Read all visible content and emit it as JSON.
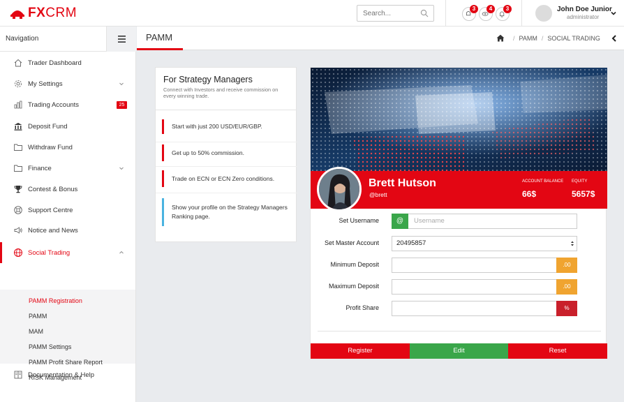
{
  "brand": {
    "fx": "FX",
    "crm": "CRM"
  },
  "header": {
    "search_placeholder": "Search...",
    "notifications": [
      {
        "icon": "bell-alt-icon",
        "count": "3"
      },
      {
        "icon": "eye-icon",
        "count": "4"
      },
      {
        "icon": "bell-icon",
        "count": "3"
      }
    ],
    "user": {
      "name": "John Doe Junior",
      "role": "administrator"
    }
  },
  "sidebar": {
    "title": "Navigation",
    "items": [
      {
        "label": "Trader Dashboard",
        "icon": "home-icon"
      },
      {
        "label": "My Settings",
        "icon": "gear-icon",
        "expand": true
      },
      {
        "label": "Trading Accounts",
        "icon": "bar-chart-icon",
        "badge": "25"
      },
      {
        "label": "Deposit Fund",
        "icon": "bank-icon"
      },
      {
        "label": "Withdraw Fund",
        "icon": "folder-icon"
      },
      {
        "label": "Finance",
        "icon": "folder-icon",
        "expand": true
      },
      {
        "label": "Contest & Bonus",
        "icon": "trophy-icon"
      },
      {
        "label": "Support Centre",
        "icon": "lifebuoy-icon"
      },
      {
        "label": "Notice and News",
        "icon": "megaphone-icon"
      },
      {
        "label": "Social Trading",
        "icon": "globe-icon",
        "expand": true,
        "active": true
      }
    ],
    "sub_items": [
      "PAMM Registration",
      "PAMM",
      "MAM",
      "PAMM Settings",
      "PAMM Profit Share Report",
      "RISK Management"
    ],
    "docs": "Documentation & Help"
  },
  "page": {
    "title": "PAMM",
    "breadcrumb": [
      "PAMM",
      "SOCIAL TRADING"
    ]
  },
  "strategy": {
    "title": "For Strategy Managers",
    "subtitle": "Connect with Investors and receive commission on every winning trade.",
    "points": [
      "Start with just 200 USD/EUR/GBP.",
      "Get up to 50% commission.",
      "Trade on ECN or ECN Zero conditions.",
      "Show your profile on the Strategy Managers Ranking page."
    ]
  },
  "profile": {
    "name": "Brett Hutson",
    "handle": "@brett",
    "balance_label": "ACCOUNT BALANCE",
    "balance": "66$",
    "equity_label": "EQUITY",
    "equity": "5657$"
  },
  "form": {
    "username_label": "Set Username",
    "username_prefix": "@",
    "username_placeholder": "Username",
    "master_label": "Set Master Account",
    "master_value": "20495857",
    "min_label": "Minimum Deposit",
    "min_suffix": ".00",
    "max_label": "Maximum Deposit",
    "max_suffix": ".00",
    "profit_label": "Profit Share",
    "profit_suffix": "%"
  },
  "actions": {
    "register": "Register",
    "edit": "Edit",
    "reset": "Reset"
  },
  "colors": {
    "brand_red": "#e30613",
    "green": "#3aa64a",
    "orange": "#f0a430",
    "dark_red": "#c9202b"
  }
}
